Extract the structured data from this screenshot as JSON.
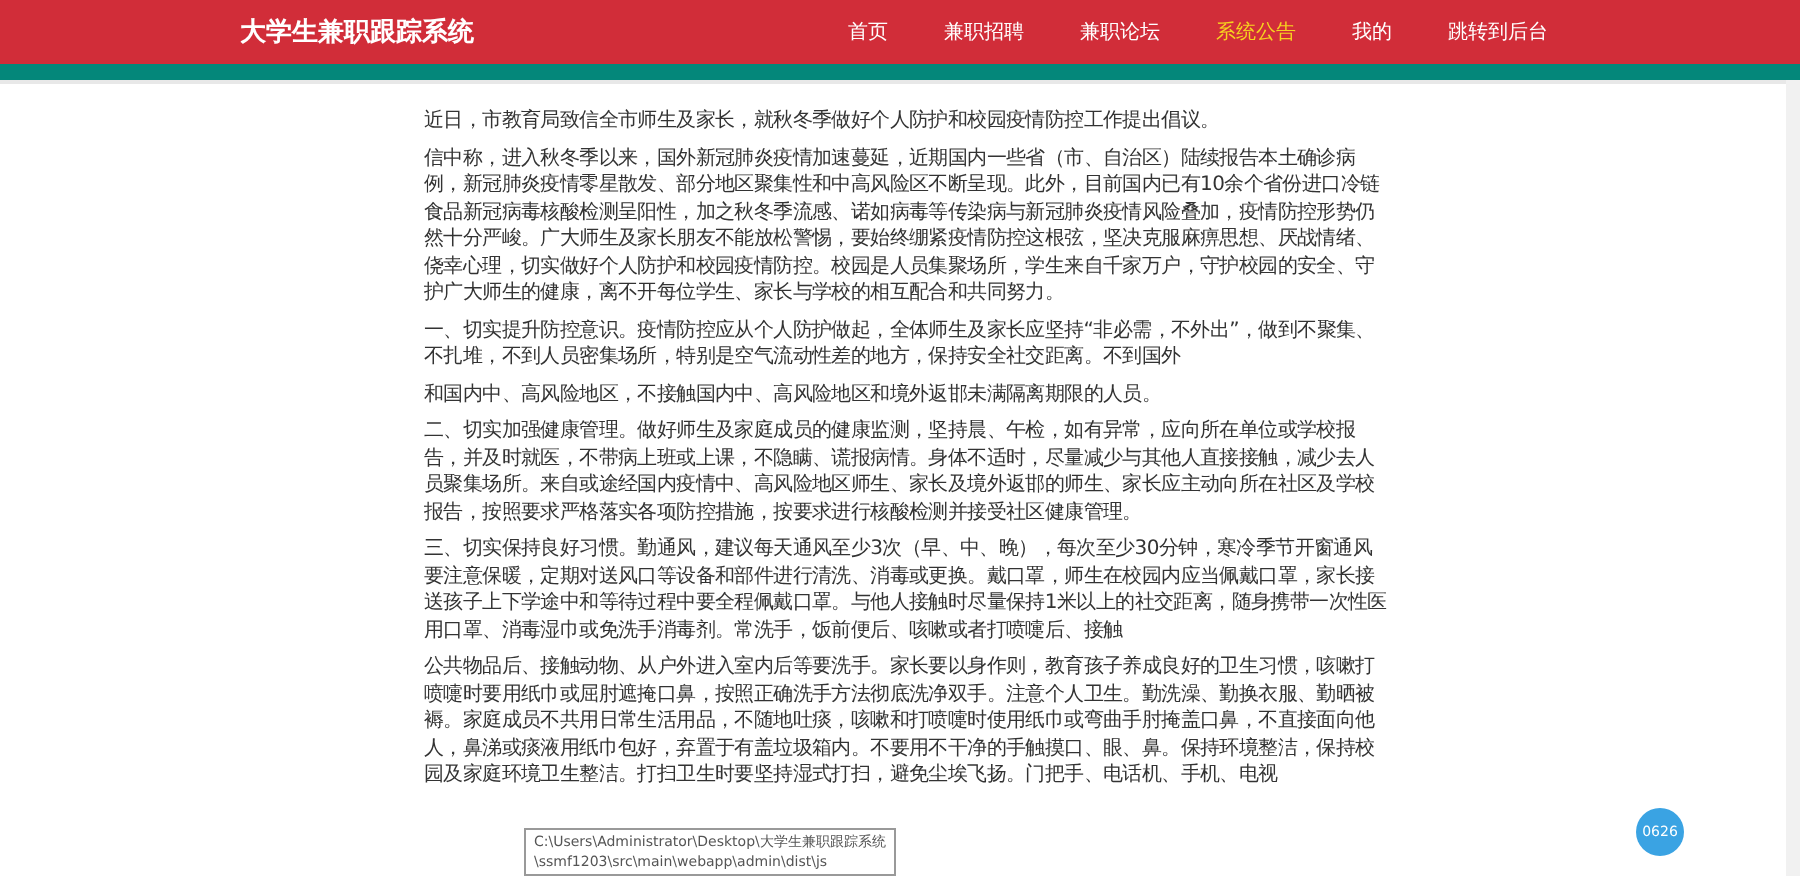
{
  "header": {
    "title": "大学生兼职跟踪系统",
    "nav": [
      {
        "label": "首页",
        "selected": false
      },
      {
        "label": "兼职招聘",
        "selected": false
      },
      {
        "label": "兼职论坛",
        "selected": false
      },
      {
        "label": "系统公告",
        "selected": true
      },
      {
        "label": "我的",
        "selected": false
      },
      {
        "label": "跳转到后台",
        "selected": false
      }
    ]
  },
  "article": {
    "paragraphs": [
      "近日，市教育局致信全市师生及家长，就秋冬季做好个人防护和校园疫情防控工作提出倡议。",
      "信中称，进入秋冬季以来，国外新冠肺炎疫情加速蔓延，近期国内一些省（市、自治区）陆续报告本土确诊病例，新冠肺炎疫情零星散发、部分地区聚集性和中高风险区不断呈现。此外，目前国内已有10余个省份进口冷链食品新冠病毒核酸检测呈阳性，加之秋冬季流感、诺如病毒等传染病与新冠肺炎疫情风险叠加，疫情防控形势仍然十分严峻。广大师生及家长朋友不能放松警惕，要始终绷紧疫情防控这根弦，坚决克服麻痹思想、厌战情绪、侥幸心理，切实做好个人防护和校园疫情防控。校园是人员集聚场所，学生来自千家万户，守护校园的安全、守护广大师生的健康，离不开每位学生、家长与学校的相互配合和共同努力。",
      "一、切实提升防控意识。疫情防控应从个人防护做起，全体师生及家长应坚持“非必需，不外出”，做到不聚集、不扎堆，不到人员密集场所，特别是空气流动性差的地方，保持安全社交距离。不到国外",
      "和国内中、高风险地区，不接触国内中、高风险地区和境外返邯未满隔离期限的人员。",
      "二、切实加强健康管理。做好师生及家庭成员的健康监测，坚持晨、午检，如有异常，应向所在单位或学校报告，并及时就医，不带病上班或上课，不隐瞒、谎报病情。身体不适时，尽量减少与其他人直接接触，减少去人员聚集场所。来自或途经国内疫情中、高风险地区师生、家长及境外返邯的师生、家长应主动向所在社区及学校报告，按照要求严格落实各项防控措施，按要求进行核酸检测并接受社区健康管理。",
      "三、切实保持良好习惯。勤通风，建议每天通风至少3次（早、中、晚），每次至少30分钟，寒冷季节开窗通风要注意保暖，定期对送风口等设备和部件进行清洗、消毒或更换。戴口罩，师生在校园内应当佩戴口罩，家长接送孩子上下学途中和等待过程中要全程佩戴口罩。与他人接触时尽量保持1米以上的社交距离，随身携带一次性医用口罩、消毒湿巾或免洗手消毒剂。常洗手，饭前便后、咳嗽或者打喷嚏后、接触",
      "公共物品后、接触动物、从户外进入室内后等要洗手。家长要以身作则，教育孩子养成良好的卫生习惯，咳嗽打喷嚏时要用纸巾或屈肘遮掩口鼻，按照正确洗手方法彻底洗净双手。注意个人卫生。勤洗澡、勤换衣服、勤晒被褥。家庭成员不共用日常生活用品，不随地吐痰，咳嗽和打喷嚏时使用纸巾或弯曲手肘掩盖口鼻，不直接面向他人，鼻涕或痰液用纸巾包好，弃置于有盖垃圾箱内。不要用不干净的手触摸口、眼、鼻。保持环境整洁，保持校园及家庭环境卫生整洁。打扫卫生时要坚持湿式打扫，避免尘埃飞扬。门把手、电话机、手机、电视"
    ]
  },
  "tooltip": [
    "C:\\Users\\Administrator\\Desktop\\大学生兼职跟踪系统",
    "\\ssmf1203\\src\\main\\webapp\\admin\\dist\\js"
  ],
  "badge": "0626"
}
